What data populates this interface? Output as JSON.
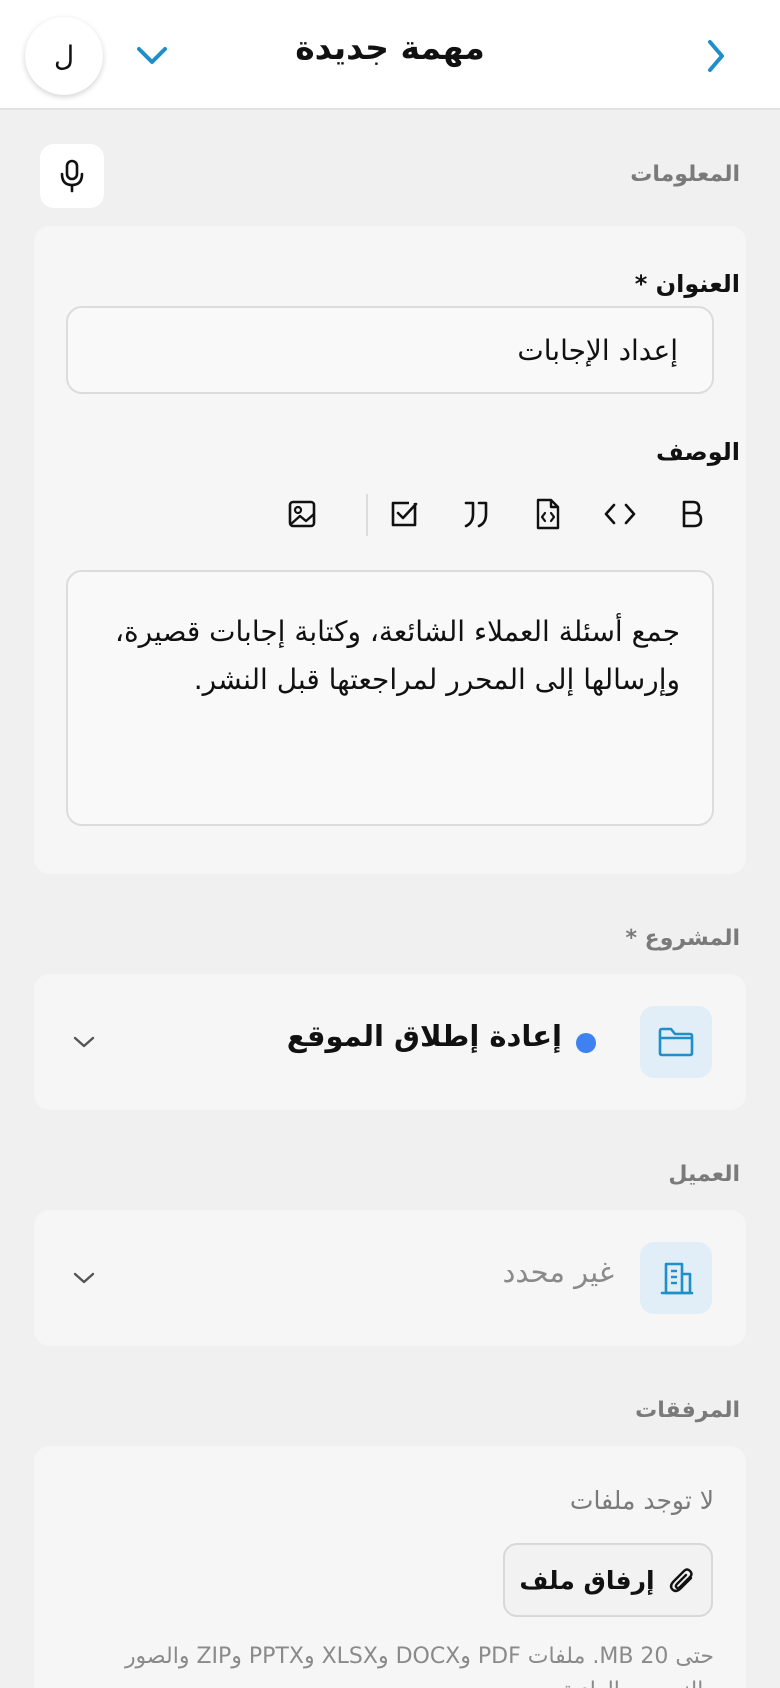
{
  "header": {
    "title": "مهمة جديدة",
    "avatar_initial": "ل"
  },
  "sections": {
    "info": "المعلومات",
    "project": "المشروع *",
    "client": "العميل",
    "attachments": "المرفقات"
  },
  "form": {
    "title_label": "العنوان *",
    "title_value": "إعداد الإجابات",
    "description_label": "الوصف",
    "description_value": "جمع أسئلة العملاء الشائعة، وكتابة إجابات قصيرة، وإرسالها إلى المحرر لمراجعتها قبل النشر."
  },
  "toolbar": {
    "items": [
      "bold-icon",
      "code-icon",
      "code-file-icon",
      "quote-icon",
      "checkbox-icon",
      "image-icon"
    ]
  },
  "project": {
    "value": "إعادة إطلاق الموقع",
    "dot_color": "#3d82f0"
  },
  "client": {
    "value": "غير محدد"
  },
  "attachments": {
    "empty_text": "لا توجد ملفات",
    "attach_label": "إرفاق ملف",
    "hint": "حتى MB 20. ملفات PDF وDOCX وXLSX وPPTX وZIP والصور والنصوص العادية."
  },
  "colors": {
    "accent": "#1f8ec9",
    "icon_bg": "#e1eef7"
  }
}
